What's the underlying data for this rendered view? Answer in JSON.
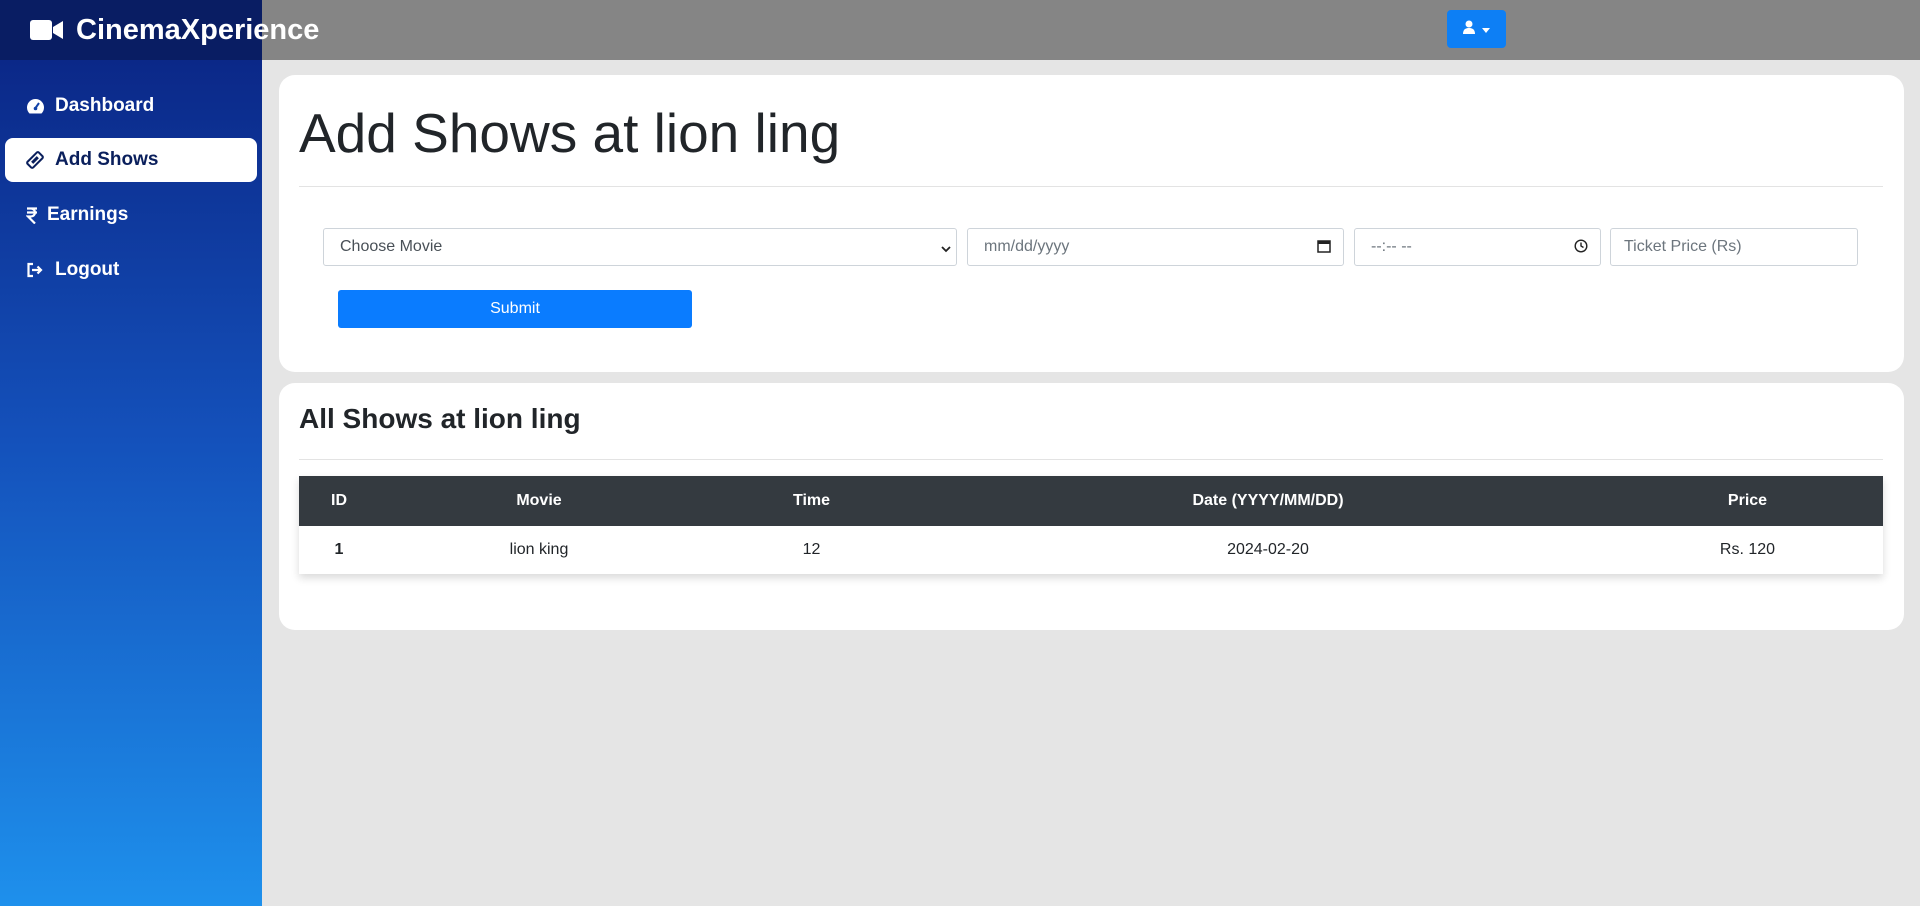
{
  "app": {
    "brand": "CinemaXperience"
  },
  "sidebar": {
    "items": [
      {
        "label": "Dashboard",
        "icon": "tachometer-icon"
      },
      {
        "label": "Add Shows",
        "icon": "ticket-icon",
        "active": true
      },
      {
        "label": "Earnings",
        "icon": "rupee-icon"
      },
      {
        "label": "Logout",
        "icon": "sign-out-icon"
      }
    ]
  },
  "add_form": {
    "title": "Add Shows at lion ling",
    "movie_select": "Choose Movie",
    "date_placeholder": "mm/dd/yyyy",
    "time_placeholder": "--:-- --",
    "price_placeholder": "Ticket Price (Rs)",
    "submit_label": "Submit"
  },
  "shows": {
    "title": "All Shows at lion ling",
    "headers": [
      "ID",
      "Movie",
      "Time",
      "Date (YYYY/MM/DD)",
      "Price"
    ],
    "rows": [
      {
        "id": "1",
        "movie": "lion king",
        "time": "12",
        "date": "2024-02-20",
        "price": "Rs. 120"
      }
    ]
  },
  "colors": {
    "accent": "#0a7cff",
    "sidebar_top": "#0b2888",
    "sidebar_bottom": "#1e90ec",
    "table_header": "#343a40"
  }
}
